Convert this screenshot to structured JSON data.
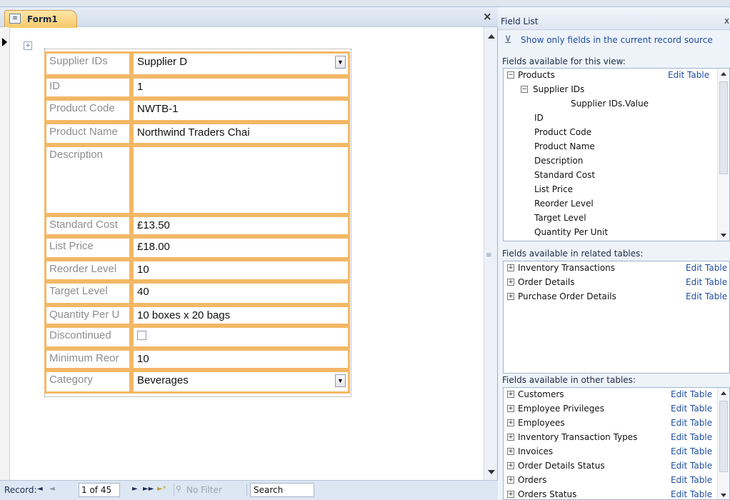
{
  "form": {
    "tab_title": "Form1",
    "tab_icon": "form-icon",
    "close_glyph": "×",
    "fields": [
      {
        "label": "Supplier IDs",
        "value": "Supplier D",
        "control": "combo"
      },
      {
        "label": "ID",
        "value": "1",
        "control": "text"
      },
      {
        "label": "Product Code",
        "value": "NWTB-1",
        "control": "text"
      },
      {
        "label": "Product Name",
        "value": "Northwind Traders Chai",
        "control": "text"
      },
      {
        "label": "Description",
        "value": "",
        "control": "memo"
      },
      {
        "label": "Standard Cost",
        "value": "£13.50",
        "control": "text"
      },
      {
        "label": "List Price",
        "value": "£18.00",
        "control": "text"
      },
      {
        "label": "Reorder Level",
        "value": "10",
        "control": "text"
      },
      {
        "label": "Target Level",
        "value": "40",
        "control": "text"
      },
      {
        "label": "Quantity Per U",
        "value": "10 boxes x 20 bags",
        "control": "text"
      },
      {
        "label": "Discontinued",
        "value": "",
        "checked": false,
        "control": "checkbox"
      },
      {
        "label": "Minimum Reor",
        "value": "10",
        "control": "text"
      },
      {
        "label": "Category",
        "value": "Beverages",
        "control": "combo"
      }
    ]
  },
  "navigation": {
    "record_label": "Record:",
    "position": "1 of 45",
    "first_glyph": "◄",
    "prev_glyph": "◄",
    "next_glyph": "►",
    "last_glyph": "►►",
    "new_glyph": "►*",
    "filter_label": "No Filter",
    "search_label": "Search"
  },
  "field_list": {
    "title": "Field List",
    "close_glyph": "x",
    "filter_link": "Show only fields in the current record source",
    "section_view": "Fields available for this view:",
    "section_related": "Fields available in related tables:",
    "section_other": "Fields available in other tables:",
    "edit_label": "Edit Table",
    "view_tree": [
      {
        "text": "Products",
        "expander": "−",
        "edit": true
      },
      {
        "text": "Supplier IDs",
        "expander": "−",
        "edit": false
      },
      {
        "text": "Supplier IDs.Value",
        "expander": "",
        "edit": false
      },
      {
        "text": "ID",
        "expander": "",
        "edit": false
      },
      {
        "text": "Product Code",
        "expander": "",
        "edit": false
      },
      {
        "text": "Product Name",
        "expander": "",
        "edit": false
      },
      {
        "text": "Description",
        "expander": "",
        "edit": false
      },
      {
        "text": "Standard Cost",
        "expander": "",
        "edit": false
      },
      {
        "text": "List Price",
        "expander": "",
        "edit": false
      },
      {
        "text": "Reorder Level",
        "expander": "",
        "edit": false
      },
      {
        "text": "Target Level",
        "expander": "",
        "edit": false
      },
      {
        "text": "Quantity Per Unit",
        "expander": "",
        "edit": false
      }
    ],
    "related_tables": [
      {
        "text": "Inventory Transactions",
        "expander": "+"
      },
      {
        "text": "Order Details",
        "expander": "+"
      },
      {
        "text": "Purchase Order Details",
        "expander": "+"
      }
    ],
    "other_tables": [
      {
        "text": "Customers",
        "expander": "+"
      },
      {
        "text": "Employee Privileges",
        "expander": "+"
      },
      {
        "text": "Employees",
        "expander": "+"
      },
      {
        "text": "Inventory Transaction Types",
        "expander": "+"
      },
      {
        "text": "Invoices",
        "expander": "+"
      },
      {
        "text": "Order Details Status",
        "expander": "+"
      },
      {
        "text": "Orders",
        "expander": "+"
      },
      {
        "text": "Orders Status",
        "expander": "+"
      }
    ]
  }
}
